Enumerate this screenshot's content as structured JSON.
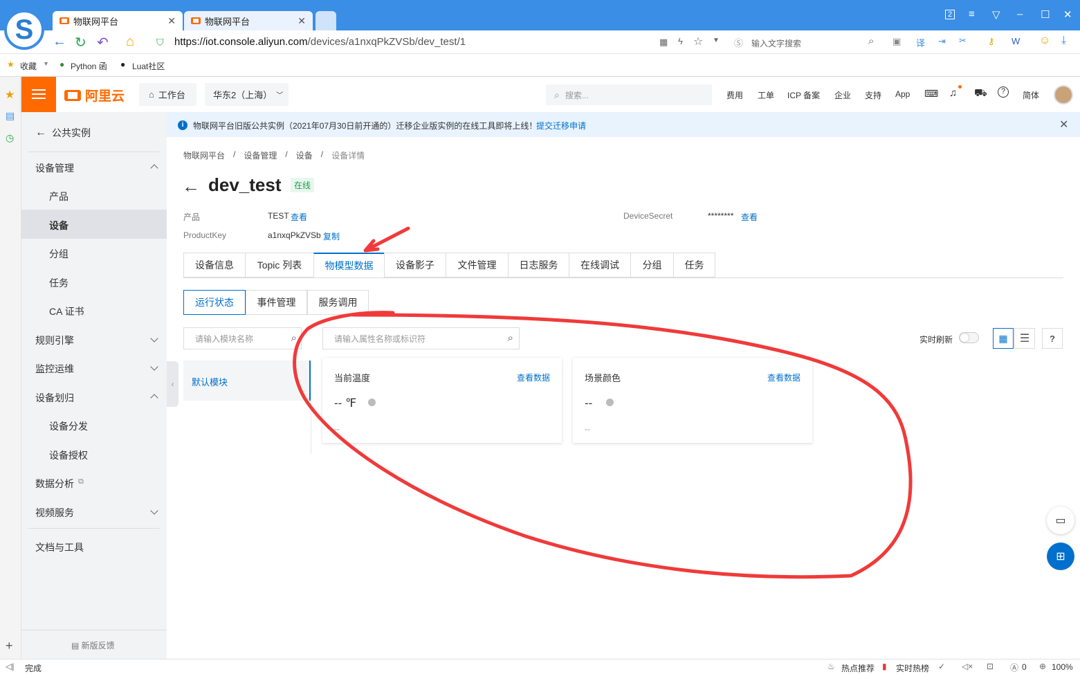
{
  "browser": {
    "tabs": [
      {
        "label": "物联网平台",
        "active": true
      },
      {
        "label": "物联网平台",
        "active": false
      }
    ],
    "tab_badge": "2",
    "url_host": "https://iot.console.aliyun.com",
    "url_path": "/devices/a1nxqPkZVSb/dev_test/1",
    "search_placeholder": "输入文字搜索",
    "bookmarks": [
      "收藏",
      "Python 函",
      "Luat社区"
    ]
  },
  "header": {
    "logo": "阿里云",
    "workbench": "工作台",
    "region": "华东2（上海）",
    "search_placeholder": "搜索...",
    "links": [
      "费用",
      "工单",
      "ICP 备案",
      "企业",
      "支持",
      "App"
    ],
    "lang": "简体"
  },
  "sidebar": {
    "back_label": "公共实例",
    "items": [
      {
        "label": "设备管理",
        "type": "group",
        "expanded": true
      },
      {
        "label": "产品",
        "type": "sub"
      },
      {
        "label": "设备",
        "type": "sub",
        "active": true
      },
      {
        "label": "分组",
        "type": "sub"
      },
      {
        "label": "任务",
        "type": "sub"
      },
      {
        "label": "CA 证书",
        "type": "sub"
      },
      {
        "label": "规则引擎",
        "type": "group",
        "expanded": false
      },
      {
        "label": "监控运维",
        "type": "group",
        "expanded": false
      },
      {
        "label": "设备划归",
        "type": "group",
        "expanded": true
      },
      {
        "label": "设备分发",
        "type": "sub"
      },
      {
        "label": "设备授权",
        "type": "sub"
      },
      {
        "label": "数据分析",
        "type": "group"
      },
      {
        "label": "视频服务",
        "type": "group",
        "expanded": false
      },
      {
        "label": "文档与工具",
        "type": "group"
      }
    ],
    "feedback": "新版反馈"
  },
  "notice": {
    "text": "物联网平台旧版公共实例（2021年07月30日前开通的）迁移企业版实例的在线工具即将上线！",
    "link": "提交迁移申请"
  },
  "breadcrumb": [
    "物联网平台",
    "设备管理",
    "设备",
    "设备详情"
  ],
  "device": {
    "name": "dev_test",
    "status": "在线",
    "product_label": "产品",
    "product_value": "TEST",
    "view_link": "查看",
    "productkey_label": "ProductKey",
    "productkey_value": "a1nxqPkZVSb",
    "copy_link": "复制",
    "secret_label": "DeviceSecret",
    "secret_value": "********",
    "secret_view": "查看"
  },
  "tabs": [
    "设备信息",
    "Topic 列表",
    "物模型数据",
    "设备影子",
    "文件管理",
    "日志服务",
    "在线调试",
    "分组",
    "任务"
  ],
  "active_tab": "物模型数据",
  "subtabs": [
    "运行状态",
    "事件管理",
    "服务调用"
  ],
  "active_subtab": "运行状态",
  "module_search_placeholder": "请输入模块名称",
  "prop_search_placeholder": "请输入属性名称或标识符",
  "realtime_label": "实时刷新",
  "default_module": "默认模块",
  "cards": [
    {
      "title": "当前温度",
      "link": "查看数据",
      "value": "-- ℉",
      "time": "--"
    },
    {
      "title": "场景颜色",
      "link": "查看数据",
      "value": "--",
      "time": "--"
    }
  ],
  "status_bar": {
    "left": "完成",
    "hot": "热点推荐",
    "realtime_hot": "实时热榜",
    "count": "0",
    "zoom": "100%"
  },
  "colors": {
    "accent": "#ff6a00",
    "link": "#0070cc",
    "annotation": "#f03a3a"
  }
}
